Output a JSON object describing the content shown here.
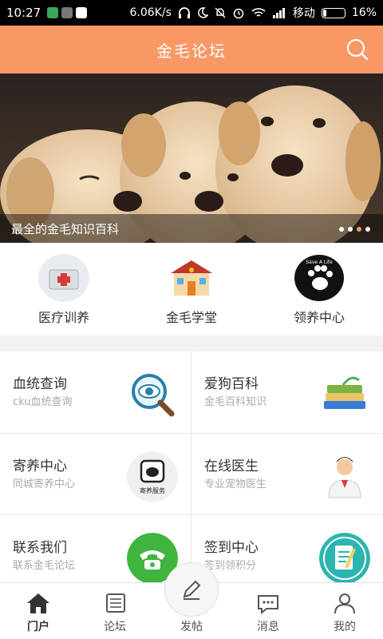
{
  "status_bar": {
    "time": "10:27",
    "network_speed": "6.06K/s",
    "carrier": "移动",
    "battery": "16%",
    "battery_level": 0.16
  },
  "header": {
    "title": "金毛论坛"
  },
  "banner": {
    "caption": "最全的金毛知识百科",
    "slide_count": 4,
    "active_slide": 3
  },
  "categories": [
    {
      "label": "医疗训养"
    },
    {
      "label": "金毛学堂"
    },
    {
      "label": "领养中心"
    }
  ],
  "services": [
    {
      "title": "血统查询",
      "subtitle": "cku血统查询"
    },
    {
      "title": "爱狗百科",
      "subtitle": "金毛百科知识"
    },
    {
      "title": "寄养中心",
      "subtitle": "同城寄养中心"
    },
    {
      "title": "在线医生",
      "subtitle": "专业宠物医生"
    },
    {
      "title": "联系我们",
      "subtitle": "联系金毛论坛"
    },
    {
      "title": "签到中心",
      "subtitle": "签到领积分"
    }
  ],
  "service_icon_text": {
    "foster": "寄养服务"
  },
  "adopt_icon_text": "Save A Life",
  "tabbar": {
    "items": [
      {
        "label": "门户"
      },
      {
        "label": "论坛"
      },
      {
        "label": "发帖"
      },
      {
        "label": "消息"
      },
      {
        "label": "我的"
      }
    ],
    "active": 0
  },
  "colors": {
    "brand": "#f89865",
    "accent_green": "#3fb53f"
  }
}
